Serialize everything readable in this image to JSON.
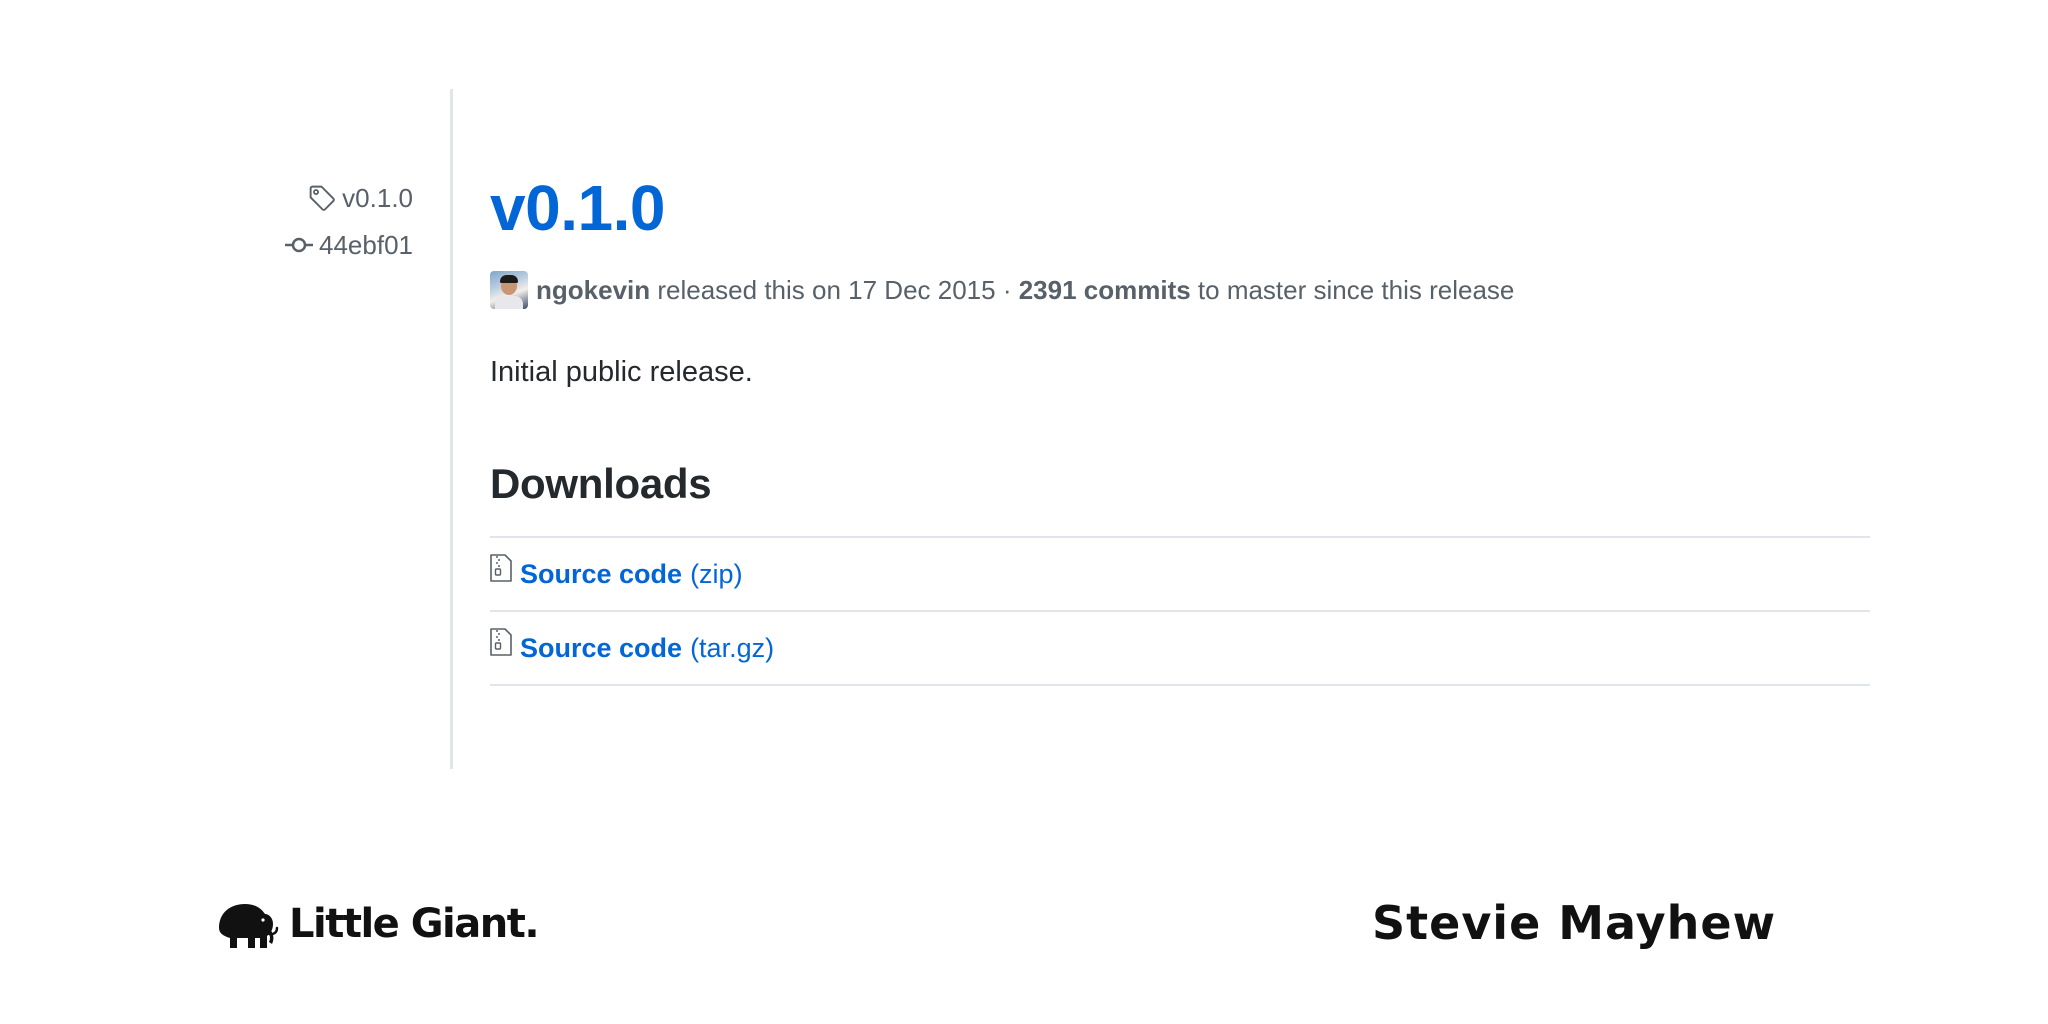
{
  "sidebar": {
    "tag_label": "v0.1.0",
    "commit_label": "44ebf01"
  },
  "release": {
    "title": "v0.1.0",
    "author": "ngokevin",
    "released_text": " released this on 17 Dec 2015 · ",
    "commits_text": "2391 commits",
    "since_text": " to master since this release",
    "notes": "Initial public release."
  },
  "downloads": {
    "heading": "Downloads",
    "items": [
      {
        "name": "Source code",
        "ext": "(zip)"
      },
      {
        "name": "Source code",
        "ext": "(tar.gz)"
      }
    ]
  },
  "footer": {
    "brand": "Little Giant.",
    "credit": "Stevie Mayhew"
  },
  "colors": {
    "link": "#0366d6",
    "muted": "#586069",
    "border": "#e1e4e8",
    "text": "#24292e"
  },
  "icons": [
    "tag-icon",
    "git-commit-icon",
    "file-zip-icon",
    "mammoth-logo-icon"
  ]
}
